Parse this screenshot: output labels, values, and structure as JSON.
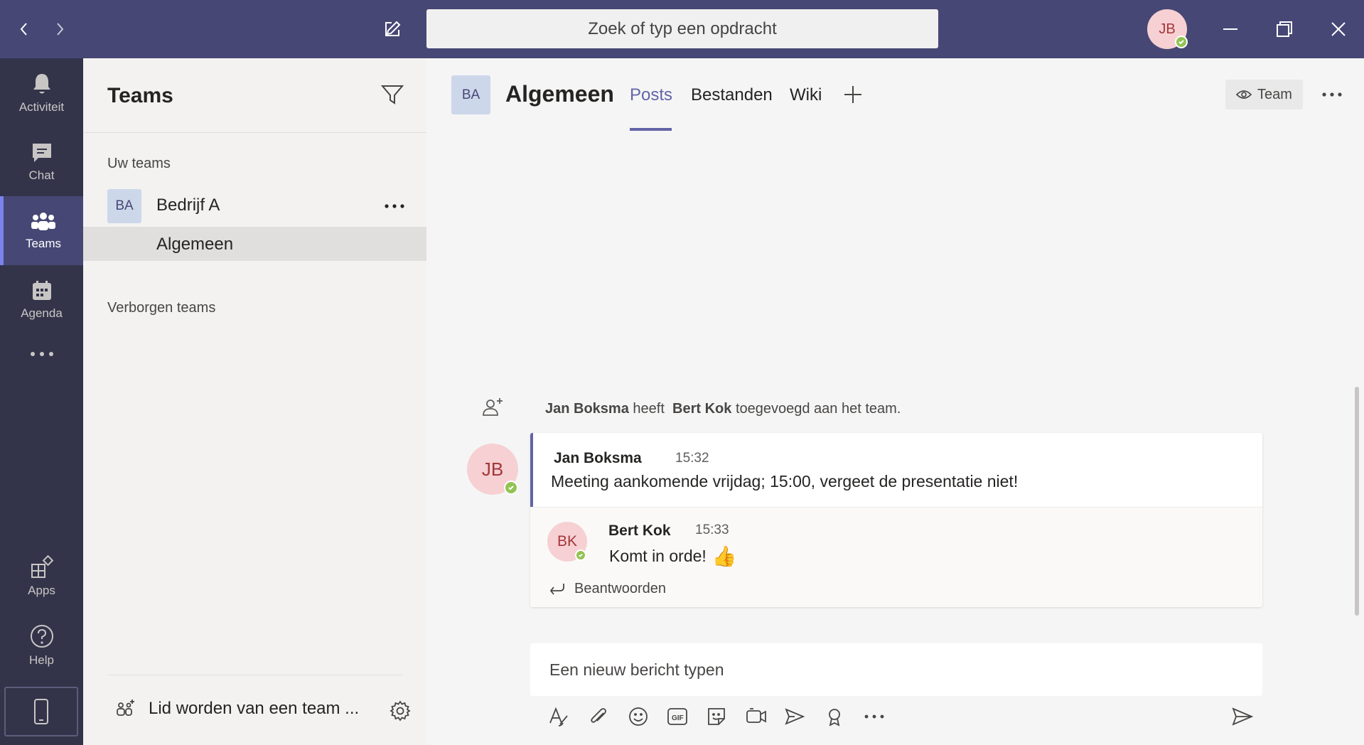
{
  "titlebar": {
    "search_placeholder": "Zoek of typ een opdracht",
    "user_initials": "JB"
  },
  "rail": {
    "items": [
      {
        "label": "Activiteit",
        "icon": "bell-icon"
      },
      {
        "label": "Chat",
        "icon": "chat-icon"
      },
      {
        "label": "Teams",
        "icon": "teams-icon",
        "active": true
      },
      {
        "label": "Agenda",
        "icon": "calendar-icon"
      },
      {
        "label": "Apps",
        "icon": "apps-icon"
      },
      {
        "label": "Help",
        "icon": "help-icon"
      }
    ]
  },
  "teams_panel": {
    "title": "Teams",
    "your_teams_label": "Uw teams",
    "team": {
      "initials": "BA",
      "name": "Bedrijf A"
    },
    "channel": {
      "name": "Algemeen"
    },
    "hidden_teams_label": "Verborgen teams",
    "join_label": "Lid worden van een team ..."
  },
  "channel_header": {
    "initials": "BA",
    "title": "Algemeen",
    "tabs": [
      {
        "label": "Posts",
        "active": true
      },
      {
        "label": "Bestanden"
      },
      {
        "label": "Wiki"
      }
    ],
    "team_button_label": "Team"
  },
  "conversation": {
    "system_message": {
      "actor": "Jan Boksma",
      "verb": "heeft",
      "target": "Bert Kok",
      "rest": "toegevoegd aan het team."
    },
    "post": {
      "author": "Jan Boksma",
      "initials": "JB",
      "time": "15:32",
      "body": "Meeting aankomende vrijdag; 15:00, vergeet de presentatie niet!"
    },
    "reply": {
      "author": "Bert Kok",
      "initials": "BK",
      "time": "15:33",
      "body": "Komt in orde!",
      "emoji": "👍"
    },
    "reply_link_label": "Beantwoorden"
  },
  "compose": {
    "placeholder": "Een nieuw bericht typen"
  },
  "colors": {
    "titlebar": "#464775",
    "rail": "#33344a",
    "accent": "#6264a7",
    "presence": "#92c353"
  }
}
